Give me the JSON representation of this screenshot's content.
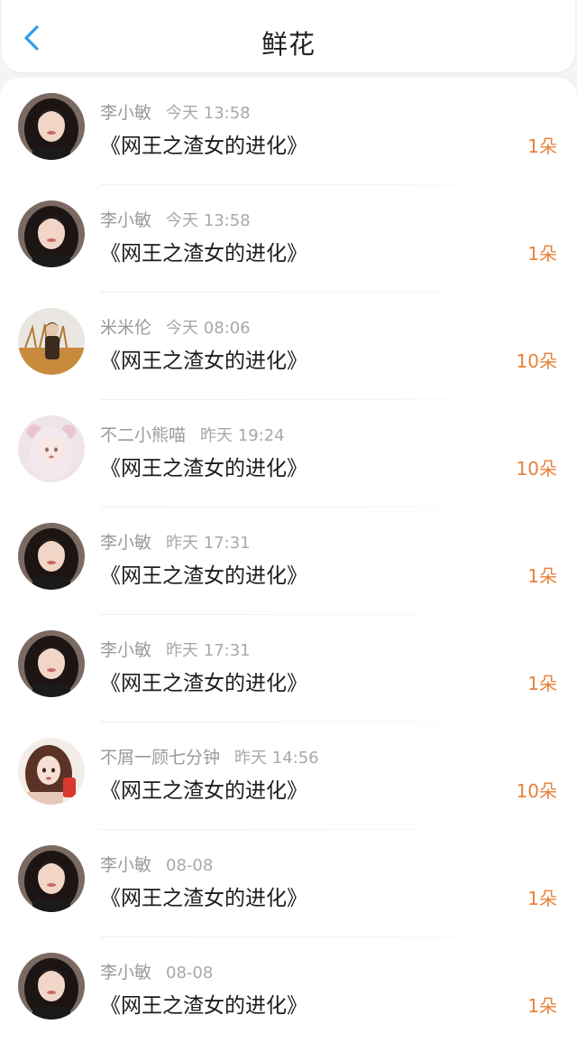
{
  "header": {
    "title": "鲜花"
  },
  "items": [
    {
      "user": "李小敏",
      "time": "今天 13:58",
      "book": "《网王之渣女的进化》",
      "count": "1朵",
      "avatar": "girl-a"
    },
    {
      "user": "李小敏",
      "time": "今天 13:58",
      "book": "《网王之渣女的进化》",
      "count": "1朵",
      "avatar": "girl-a"
    },
    {
      "user": "米米伦",
      "time": "今天 08:06",
      "book": "《网王之渣女的进化》",
      "count": "10朵",
      "avatar": "field-boy"
    },
    {
      "user": "不二小熊喵",
      "time": "昨天 19:24",
      "book": "《网王之渣女的进化》",
      "count": "10朵",
      "avatar": "anime-girl"
    },
    {
      "user": "李小敏",
      "time": "昨天 17:31",
      "book": "《网王之渣女的进化》",
      "count": "1朵",
      "avatar": "girl-a"
    },
    {
      "user": "李小敏",
      "time": "昨天 17:31",
      "book": "《网王之渣女的进化》",
      "count": "1朵",
      "avatar": "girl-a"
    },
    {
      "user": "不屑一顾七分钟",
      "time": "昨天 14:56",
      "book": "《网王之渣女的进化》",
      "count": "10朵",
      "avatar": "drawn-girl"
    },
    {
      "user": "李小敏",
      "time": "08-08",
      "book": "《网王之渣女的进化》",
      "count": "1朵",
      "avatar": "girl-a"
    },
    {
      "user": "李小敏",
      "time": "08-08",
      "book": "《网王之渣女的进化》",
      "count": "1朵",
      "avatar": "girl-a"
    }
  ],
  "colors": {
    "accent_back": "#2f9bf0",
    "count": "#e8813a",
    "meta": "#9a9a9a",
    "text": "#1c1c1c"
  }
}
